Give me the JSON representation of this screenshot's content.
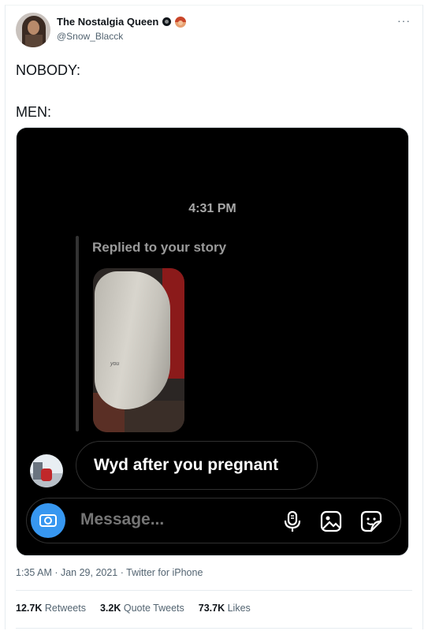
{
  "tweet": {
    "display_name": "The Nostalgia Queen",
    "handle": "@Snow_Blacck",
    "more_label": "···",
    "text_line1": "NOBODY:",
    "text_line2": "MEN:",
    "timestamp": "1:35 AM · Jan 29, 2021 · Twitter for iPhone",
    "stats": {
      "retweets_count": "12.7K",
      "retweets_label": "Retweets",
      "quotes_count": "3.2K",
      "quotes_label": "Quote Tweets",
      "likes_count": "73.7K",
      "likes_label": "Likes"
    }
  },
  "dm": {
    "time": "4:31 PM",
    "replied_label": "Replied to your story",
    "message": "Wyd after you pregnant",
    "composer_placeholder": "Message...",
    "story_tag": "you"
  },
  "colors": {
    "accent_blue": "#3797f0",
    "text_primary": "#0f1419",
    "text_secondary": "#536471",
    "dm_background": "#000000"
  },
  "icons": {
    "verified": "verified-badge-icon",
    "emoji": "woman-red-hair-emoji-icon",
    "camera": "camera-icon",
    "mic": "microphone-icon",
    "gallery": "gallery-icon",
    "sticker": "sticker-icon"
  }
}
